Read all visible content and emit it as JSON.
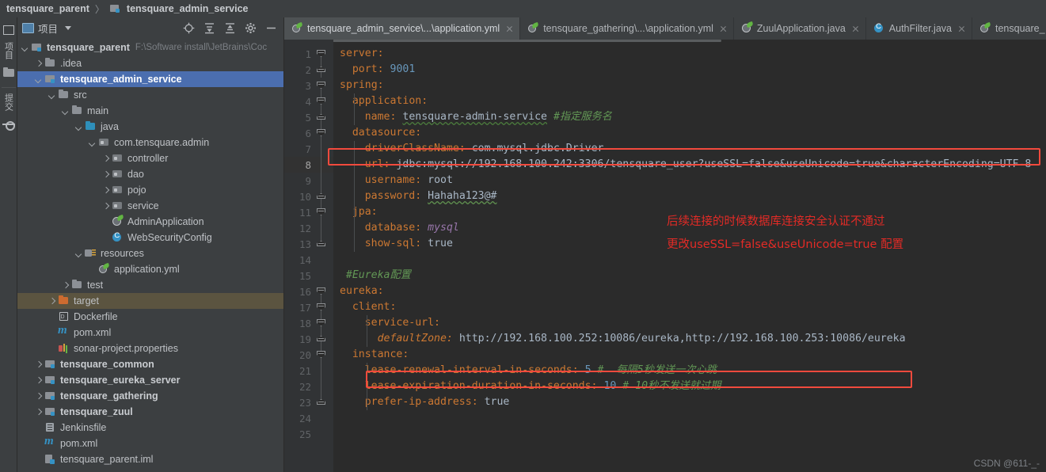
{
  "breadcrumb": {
    "root": "tensquare_parent",
    "separator": "〉",
    "current": "tensquare_admin_service"
  },
  "toolstrip": {
    "project_label": "项目",
    "commit_label": "提交",
    "icons": [
      "grid-icon",
      "folder-icon",
      "commit-icon"
    ]
  },
  "project_panel": {
    "title": "项目",
    "toolbar_icons": [
      "locate-target-icon",
      "expand-all-icon",
      "collapse-all-icon",
      "settings-gear-icon",
      "minimize-icon"
    ],
    "tree": [
      {
        "depth": 0,
        "arrow": "down",
        "icon": "ic-mod",
        "label": "tensquare_parent",
        "bold": true,
        "sub": "F:\\Software install\\JetBrains\\Coc"
      },
      {
        "depth": 1,
        "arrow": "right",
        "icon": "ic-dir",
        "label": ".idea",
        "bold": false,
        "sub": ""
      },
      {
        "depth": 1,
        "arrow": "down",
        "icon": "ic-mod",
        "label": "tensquare_admin_service",
        "bold": true,
        "sub": "",
        "state": "selected"
      },
      {
        "depth": 2,
        "arrow": "down",
        "icon": "ic-dir",
        "label": "src",
        "bold": false,
        "sub": ""
      },
      {
        "depth": 3,
        "arrow": "down",
        "icon": "ic-dir",
        "label": "main",
        "bold": false,
        "sub": ""
      },
      {
        "depth": 4,
        "arrow": "down",
        "icon": "ic-src",
        "label": "java",
        "bold": false,
        "sub": ""
      },
      {
        "depth": 5,
        "arrow": "down",
        "icon": "ic-pkg",
        "label": "com.tensquare.admin",
        "bold": false,
        "sub": ""
      },
      {
        "depth": 6,
        "arrow": "right",
        "icon": "ic-pkg",
        "label": "controller",
        "bold": false,
        "sub": ""
      },
      {
        "depth": 6,
        "arrow": "right",
        "icon": "ic-pkg",
        "label": "dao",
        "bold": false,
        "sub": ""
      },
      {
        "depth": 6,
        "arrow": "right",
        "icon": "ic-pkg",
        "label": "pojo",
        "bold": false,
        "sub": ""
      },
      {
        "depth": 6,
        "arrow": "right",
        "icon": "ic-pkg",
        "label": "service",
        "bold": false,
        "sub": ""
      },
      {
        "depth": 6,
        "arrow": "none",
        "icon": "ic-spring",
        "label": "AdminApplication",
        "bold": false,
        "sub": ""
      },
      {
        "depth": 6,
        "arrow": "none",
        "icon": "ic-cls",
        "label": "WebSecurityConfig",
        "bold": false,
        "sub": ""
      },
      {
        "depth": 4,
        "arrow": "down",
        "icon": "ic-res",
        "label": "resources",
        "bold": false,
        "sub": ""
      },
      {
        "depth": 5,
        "arrow": "none",
        "icon": "ic-yml",
        "label": "application.yml",
        "bold": false,
        "sub": ""
      },
      {
        "depth": 3,
        "arrow": "right",
        "icon": "ic-dir",
        "label": "test",
        "bold": false,
        "sub": ""
      },
      {
        "depth": 2,
        "arrow": "right",
        "icon": "ic-target",
        "label": "target",
        "bold": false,
        "sub": "",
        "state": "highlighted"
      },
      {
        "depth": 2,
        "arrow": "none",
        "icon": "ic-docker",
        "label": "Dockerfile",
        "bold": false,
        "sub": ""
      },
      {
        "depth": 2,
        "arrow": "none",
        "icon": "ic-maven",
        "label": "pom.xml",
        "bold": false,
        "sub": ""
      },
      {
        "depth": 2,
        "arrow": "none",
        "icon": "ic-sonar",
        "label": "sonar-project.properties",
        "bold": false,
        "sub": ""
      },
      {
        "depth": 1,
        "arrow": "right",
        "icon": "ic-mod",
        "label": "tensquare_common",
        "bold": true,
        "sub": ""
      },
      {
        "depth": 1,
        "arrow": "right",
        "icon": "ic-mod",
        "label": "tensquare_eureka_server",
        "bold": true,
        "sub": ""
      },
      {
        "depth": 1,
        "arrow": "right",
        "icon": "ic-mod",
        "label": "tensquare_gathering",
        "bold": true,
        "sub": ""
      },
      {
        "depth": 1,
        "arrow": "right",
        "icon": "ic-mod",
        "label": "tensquare_zuul",
        "bold": true,
        "sub": ""
      },
      {
        "depth": 1,
        "arrow": "none",
        "icon": "ic-jenkins",
        "label": "Jenkinsfile",
        "bold": false,
        "sub": ""
      },
      {
        "depth": 1,
        "arrow": "none",
        "icon": "ic-maven",
        "label": "pom.xml",
        "bold": false,
        "sub": ""
      },
      {
        "depth": 1,
        "arrow": "none",
        "icon": "ic-iml",
        "label": "tensquare_parent.iml",
        "bold": false,
        "sub": ""
      }
    ]
  },
  "editor": {
    "tabs": [
      {
        "label": "tensquare_admin_service\\...\\application.yml",
        "icon": "ic-yml",
        "active": true,
        "closable": true
      },
      {
        "label": "tensquare_gathering\\...\\application.yml",
        "icon": "ic-yml",
        "active": false,
        "closable": true
      },
      {
        "label": "ZuulApplication.java",
        "icon": "ic-spring",
        "active": false,
        "closable": true
      },
      {
        "label": "AuthFilter.java",
        "icon": "ic-cls",
        "active": false,
        "closable": true
      },
      {
        "label": "tensquare_",
        "icon": "ic-yml",
        "active": false,
        "closable": false
      }
    ],
    "line_numbers": [
      "1",
      "2",
      "3",
      "4",
      "5",
      "6",
      "7",
      "8",
      "9",
      "10",
      "11",
      "12",
      "13",
      "14",
      "15",
      "16",
      "17",
      "18",
      "19",
      "20",
      "21",
      "22",
      "23",
      "24",
      "25"
    ],
    "current_line": 8,
    "code_lines": [
      {
        "n": 1,
        "text": "server:"
      },
      {
        "n": 2,
        "text": "  port: 9001"
      },
      {
        "n": 3,
        "text": "spring:"
      },
      {
        "n": 4,
        "text": "  application:"
      },
      {
        "n": 5,
        "text": "    name: tensquare-admin-service #指定服务名"
      },
      {
        "n": 6,
        "text": "  datasource:"
      },
      {
        "n": 7,
        "text": "    driverClassName: com.mysql.jdbc.Driver"
      },
      {
        "n": 8,
        "text": "    url: jdbc:mysql://192.168.100.242:3306/tensquare_user?useSSL=false&useUnicode=true&characterEncoding=UTF-8"
      },
      {
        "n": 9,
        "text": "    username: root"
      },
      {
        "n": 10,
        "text": "    password: Hahaha123@#"
      },
      {
        "n": 11,
        "text": "  jpa:"
      },
      {
        "n": 12,
        "text": "    database: mysql"
      },
      {
        "n": 13,
        "text": "    show-sql: true"
      },
      {
        "n": 14,
        "text": ""
      },
      {
        "n": 15,
        "text": " #Eureka配置"
      },
      {
        "n": 16,
        "text": "eureka:"
      },
      {
        "n": 17,
        "text": "  client:"
      },
      {
        "n": 18,
        "text": "    service-url:"
      },
      {
        "n": 19,
        "text": "      defaultZone: http://192.168.100.252:10086/eureka,http://192.168.100.253:10086/eureka"
      },
      {
        "n": 20,
        "text": "  instance:"
      },
      {
        "n": 21,
        "text": "    lease-renewal-interval-in-seconds: 5 # 每隔5秒发送一次心跳"
      },
      {
        "n": 22,
        "text": "    lease-expiration-duration-in-seconds: 10 # 10秒不发送就过期"
      },
      {
        "n": 23,
        "text": "    prefer-ip-address: true"
      },
      {
        "n": 24,
        "text": ""
      },
      {
        "n": 25,
        "text": ""
      }
    ],
    "tokens": {
      "l1_key": "server:",
      "l2_key": "port:",
      "l2_num": "9001",
      "l3_key": "spring:",
      "l4_key": "application:",
      "l5_key": "name:",
      "l5_val": "tensquare-admin-service",
      "l5_cmt": "#指定服务名",
      "l6_key": "datasource:",
      "l7_key": "driverClassName:",
      "l7_val": "com.mysql.jdbc.Driver",
      "l8_key": "url:",
      "l8_val": "jdbc:mysql://192.168.100.242:3306/tensquare_user?useSSL=false&useUnicode=true&characterEncoding=UTF-8",
      "l9_key": "username:",
      "l9_val": "root",
      "l10_key": "password:",
      "l10_val": "Hahaha123@#",
      "l11_key": "jpa:",
      "l12_key": "database:",
      "l12_val": "mysql",
      "l13_key": "show-sql:",
      "l13_val": "true",
      "l15_cmt": "#Eureka配置",
      "l16_key": "eureka:",
      "l17_key": "client:",
      "l18_key": "service-url:",
      "l19_key": "defaultZone:",
      "l19_val": "http://192.168.100.252:10086/eureka,http://192.168.100.253:10086/eureka",
      "l21_key": "lease-renewal-interval-in-seconds:",
      "l21_num": "5",
      "l21_cmt": "#  每隔5秒发送一次心跳",
      "l22_key": "lease-expiration-duration-in-seconds:",
      "l22_num": "10",
      "l22_cmt": "# 10秒不发送就过期",
      "l23_key": "prefer-ip-address:",
      "l23_val": "true"
    }
  },
  "annotations": {
    "note_line1": "后续连接的时候数据库连接安全认证不通过",
    "note_line2": "更改useSSL=false&useUnicode=true 配置",
    "highlight_color": "#f24a3d",
    "note_color": "#e32b26"
  },
  "watermark": "CSDN @611-_-"
}
